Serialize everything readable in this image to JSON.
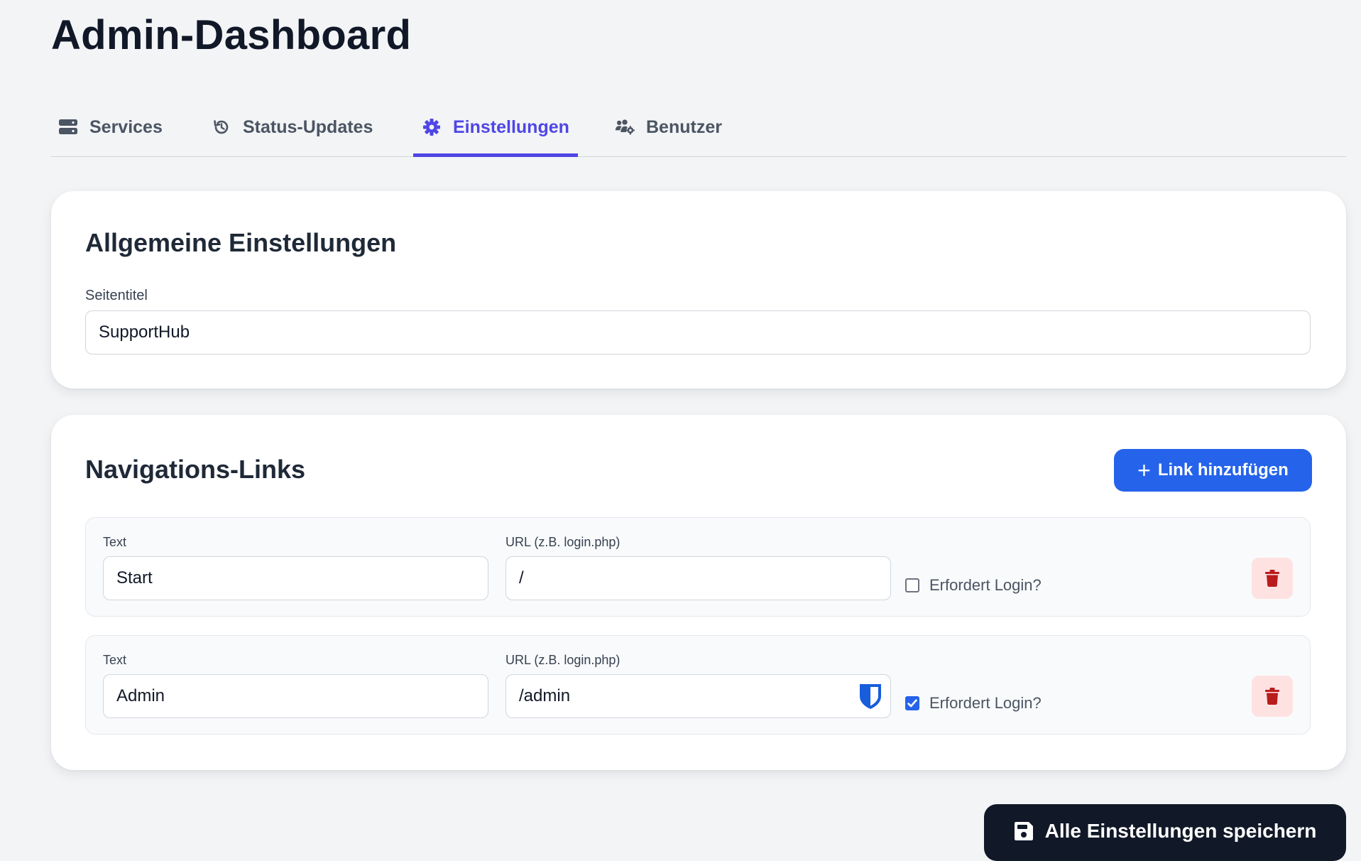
{
  "page": {
    "title": "Admin-Dashboard"
  },
  "tabs": [
    {
      "label": "Services",
      "icon": "server-icon",
      "active": false
    },
    {
      "label": "Status-Updates",
      "icon": "history-icon",
      "active": false
    },
    {
      "label": "Einstellungen",
      "icon": "gear-icon",
      "active": true
    },
    {
      "label": "Benutzer",
      "icon": "users-gear-icon",
      "active": false
    }
  ],
  "general": {
    "heading": "Allgemeine Einstellungen",
    "site_title_label": "Seitentitel",
    "site_title_value": "SupportHub"
  },
  "navigation": {
    "heading": "Navigations-Links",
    "add_button_label": "Link hinzufügen",
    "links": [
      {
        "text_label": "Text",
        "text_value": "Start",
        "url_label": "URL (z.B. login.php)",
        "url_value": "/",
        "login_label": "Erfordert Login?",
        "requires_login": false
      },
      {
        "text_label": "Text",
        "text_value": "Admin",
        "url_label": "URL (z.B. login.php)",
        "url_value": "/admin",
        "login_label": "Erfordert Login?",
        "requires_login": true
      }
    ]
  },
  "save_button_label": "Alle Einstellungen speichern",
  "colors": {
    "accent": "#4f46e5",
    "primary_button": "#2563eb",
    "delete_icon": "#b91c1c",
    "delete_bg": "#fee2e2",
    "dark_button": "#111827",
    "background": "#f3f4f6"
  }
}
